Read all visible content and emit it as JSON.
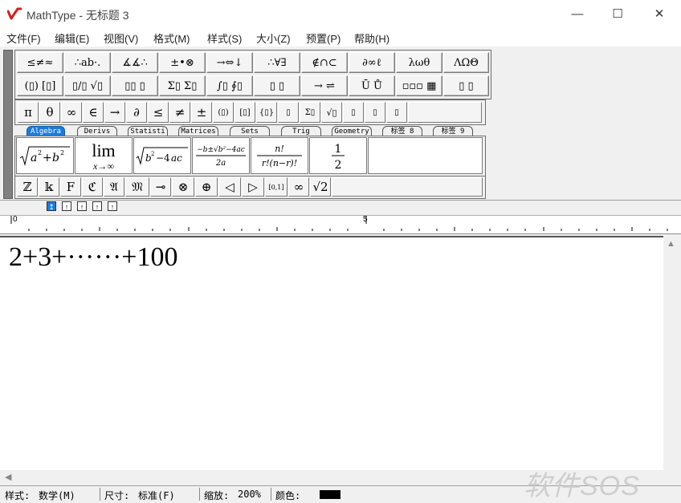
{
  "window": {
    "title": "MathType - 无标题 3",
    "buttons": {
      "minimize": "—",
      "maximize": "☐",
      "close": "✕"
    }
  },
  "menu": [
    "文件(F)",
    "编辑(E)",
    "视图(V)",
    "格式(M)",
    "样式(S)",
    "大小(Z)",
    "预置(P)",
    "帮助(H)"
  ],
  "palette_row1": [
    "≤≠≈",
    "∴ab·.",
    "∡∡∴",
    "±•⊗",
    "→⇔↓",
    "∴∀∃",
    "∉∩⊂",
    "∂∞ℓ",
    "λωθ",
    "ΛΩΘ"
  ],
  "palette_row2": [
    "(▯) [▯]",
    "▯/▯ √▯",
    "▯▯ ▯",
    "Σ▯ Σ▯",
    "∫▯ ∮▯",
    "▯ ▯",
    "→ ⇌",
    "Ū Ů",
    "▫▫▫ ▦",
    "▯ ▯"
  ],
  "symbols_row": [
    "π",
    "θ",
    "∞",
    "∈",
    "→",
    "∂",
    "≤",
    "≠",
    "±",
    "(▯)",
    "[▯]",
    "{▯}",
    "▯",
    "Σ▯",
    "√▯",
    "▯",
    "▯",
    "▯"
  ],
  "tabs": [
    "Algebra",
    "Derivs",
    "Statisti",
    "Matrices",
    "Sets",
    "Trig",
    "Geometry",
    "标签 8",
    "标签 9"
  ],
  "templates": [
    "√(a²+b²)",
    "lim x→∞",
    "√(b²−4ac)",
    "(−b±√(b²−4ac))/2a",
    "n!/r!(n−r)!",
    "1/2"
  ],
  "bottom_row": [
    "ℤ",
    "𝕜",
    "F",
    "ℭ",
    "𝔄",
    "𝔐",
    "⊸",
    "⊗",
    "⊕",
    "◁",
    "▷",
    "[0,1]",
    "∞",
    "√2"
  ],
  "ruler": {
    "marks": [
      "0",
      "5"
    ]
  },
  "equation": "2+3+······+100",
  "status": {
    "style_label": "样式:",
    "style_value": "数学(M)",
    "size_label": "尺寸:",
    "size_value": "标准(F)",
    "zoom_label": "缩放:",
    "zoom_value": "200%",
    "color_label": "颜色:",
    "color": "#000000"
  },
  "watermark": "软件SOS",
  "colors": {
    "accent": "#1a7be0",
    "logo": "#d0201c"
  }
}
